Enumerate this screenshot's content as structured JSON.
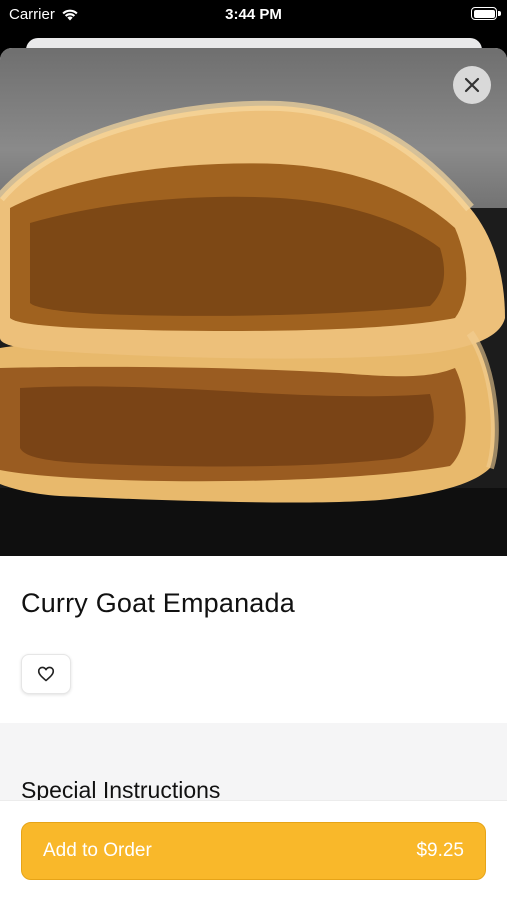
{
  "status_bar": {
    "carrier": "Carrier",
    "time": "3:44 PM"
  },
  "item": {
    "name": "Curry Goat Empanada"
  },
  "special_instructions": {
    "heading": "Special Instructions"
  },
  "footer": {
    "add_label": "Add to Order",
    "price": "$9.25"
  },
  "icons": {
    "close": "close-icon",
    "favorite": "heart-outline-icon",
    "wifi": "wifi-icon",
    "battery": "battery-icon"
  },
  "colors": {
    "accent": "#F9B82A",
    "accent_border": "#E6A418"
  }
}
